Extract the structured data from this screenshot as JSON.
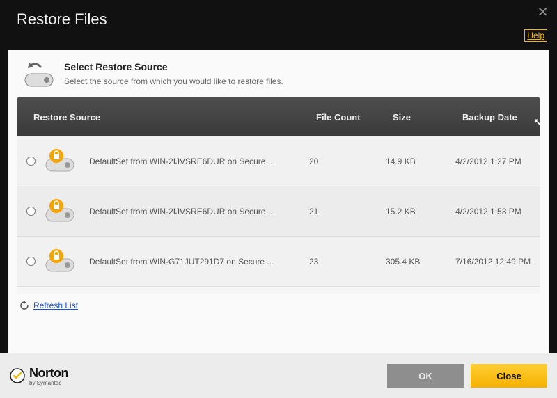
{
  "window": {
    "title": "Restore Files",
    "help_label": "Help"
  },
  "section": {
    "heading": "Select Restore Source",
    "subtext": "Select the source from which you would like to restore files."
  },
  "table": {
    "headers": {
      "source": "Restore Source",
      "file_count": "File Count",
      "size": "Size",
      "backup_date": "Backup Date"
    },
    "rows": [
      {
        "name": "DefaultSet from WIN-2IJVSRE6DUR on Secure ...",
        "file_count": "20",
        "size": "14.9 KB",
        "backup_date": "4/2/2012 1:27 PM"
      },
      {
        "name": "DefaultSet from WIN-2IJVSRE6DUR on Secure ...",
        "file_count": "21",
        "size": "15.2 KB",
        "backup_date": "4/2/2012 1:53 PM"
      },
      {
        "name": "DefaultSet from WIN-G71JUT291D7 on Secure ...",
        "file_count": "23",
        "size": "305.4 KB",
        "backup_date": "7/16/2012 12:49 PM"
      }
    ]
  },
  "actions": {
    "refresh": "Refresh List",
    "ok": "OK",
    "close": "Close"
  },
  "brand": {
    "name": "Norton",
    "byline": "by Symantec"
  },
  "colors": {
    "accent": "#f5b500",
    "header_dark": "#3e3e3e"
  }
}
